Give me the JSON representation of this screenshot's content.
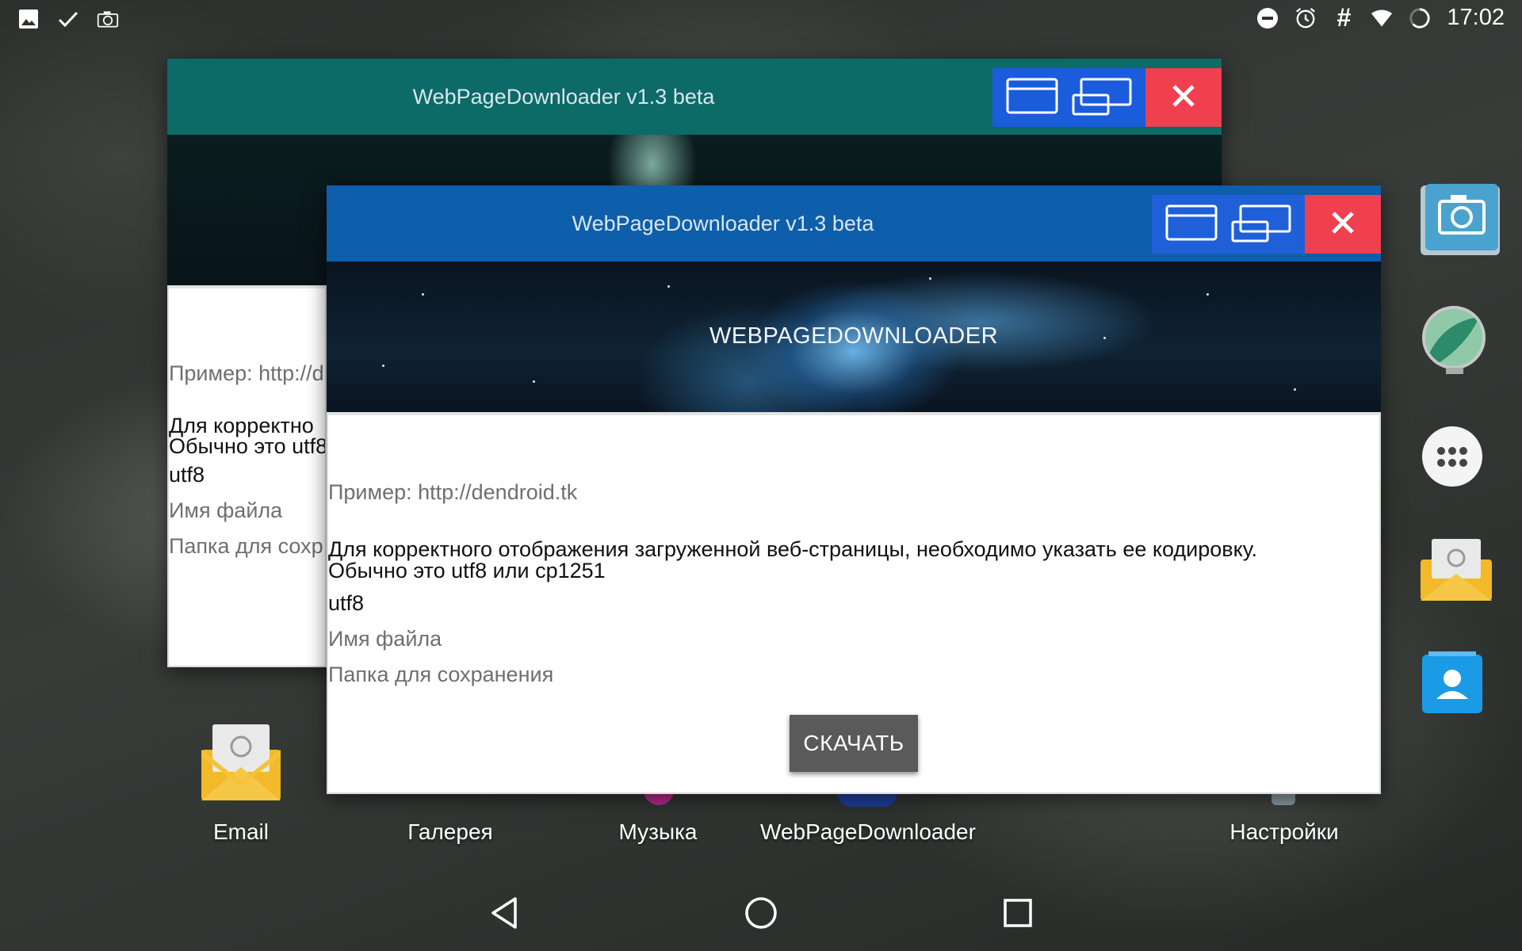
{
  "statusbar": {
    "left_icons": [
      "image-icon",
      "check-icon",
      "screenshot-icon"
    ],
    "right_icons": [
      "dnd-icon",
      "alarm-icon",
      "hash-icon",
      "wifi-icon",
      "battery-icon"
    ],
    "time": "17:02"
  },
  "window_back": {
    "title": "WebPageDownloader v1.3 beta",
    "hint_url": "Пример: http://d",
    "encoding_text_1": "Для корректно",
    "encoding_text_2": "Обычно это utf8",
    "encoding_value": "utf8",
    "filename_placeholder": "Имя файла",
    "folder_placeholder": "Папка для сохр"
  },
  "window_front": {
    "title": "WebPageDownloader v1.3 beta",
    "banner_title": "WEBPAGEDOWNLOADER",
    "hint_url": "Пример: http://dendroid.tk",
    "encoding_text_1": "Для корректного отображения загруженной веб-страницы, необходимо указать ее кодировку.",
    "encoding_text_2": "Обычно это utf8 или cp1251",
    "encoding_value": "utf8",
    "filename_placeholder": "Имя файла",
    "folder_placeholder": "Папка для сохранения",
    "download_button": "СКАЧАТЬ"
  },
  "colors": {
    "back_titlebar": "#0c6a67",
    "front_titlebar": "#0d5eab",
    "window_button_blue": "#1a5cdc",
    "close_button_red": "#f0404f"
  },
  "home_apps": [
    {
      "label": "Email"
    },
    {
      "label": "Галерея"
    },
    {
      "label": "Музыка"
    },
    {
      "label": "WebPageDownloader"
    },
    {
      "label": "Настройки"
    }
  ],
  "dock": [
    "camera-icon",
    "browser-globe-icon",
    "app-drawer-icon",
    "email-icon",
    "contacts-icon"
  ],
  "navbar": [
    "back-icon",
    "home-icon",
    "recents-icon"
  ]
}
